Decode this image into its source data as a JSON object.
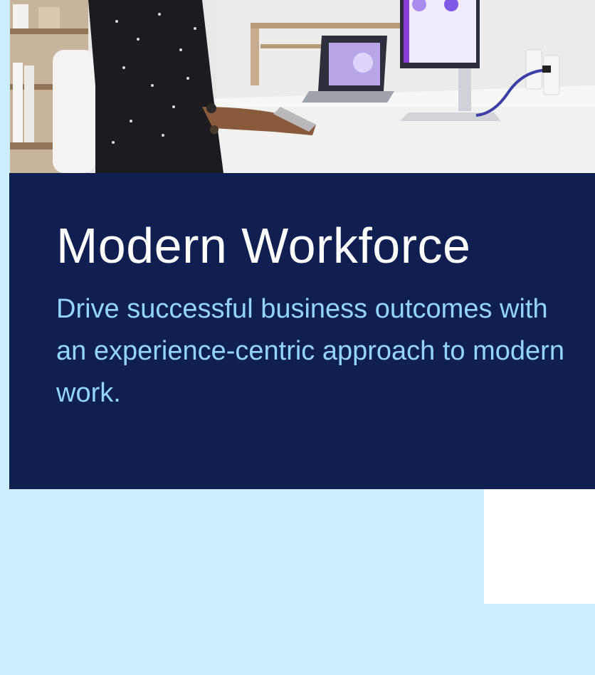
{
  "hero": {
    "title": "Modern Workforce",
    "subtitle": "Drive successful business outcomes with an experience-centric approach to modern work."
  },
  "colors": {
    "panel": "#0f1f52",
    "title": "#ffffff",
    "subtitle": "#93d5fb",
    "background": "#cbeefc"
  },
  "photo": {
    "description_icon": "office-worker-image"
  }
}
